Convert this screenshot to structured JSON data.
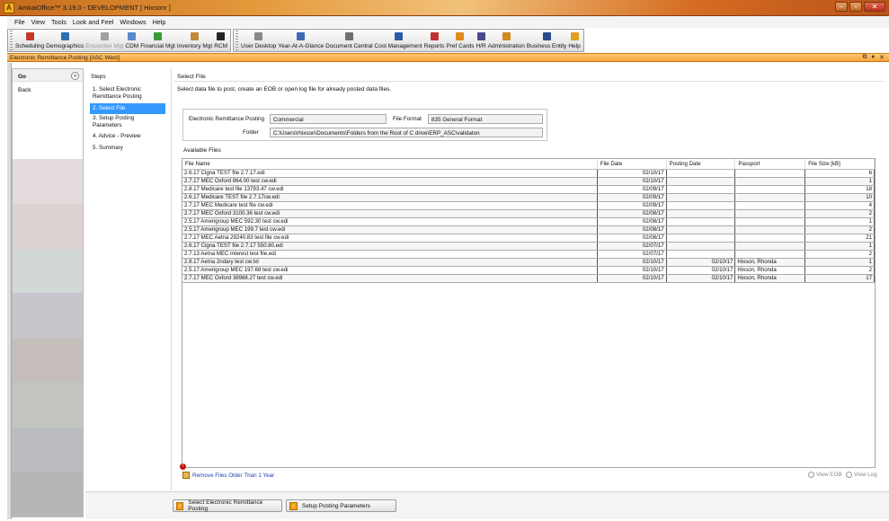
{
  "window": {
    "title": "AmkaiOffice™ 3.19.0 - DEVELOPMENT [ Hixsonr ]"
  },
  "menubar": [
    "File",
    "View",
    "Tools",
    "Look and Feel",
    "Windows",
    "Help"
  ],
  "toolbar": {
    "group1": [
      {
        "label": "Scheduling",
        "icon": "calendar-icon",
        "color": "#c0392b",
        "enabled": true
      },
      {
        "label": "Demographics",
        "icon": "people-icon",
        "color": "#2c6fb3",
        "enabled": true
      },
      {
        "label": "Encounter Mgt",
        "icon": "encounter-icon",
        "color": "#a0a0a0",
        "enabled": false
      },
      {
        "label": "CDM",
        "icon": "cdm-icon",
        "color": "#5a8acb",
        "enabled": true
      },
      {
        "label": "Financial Mgt",
        "icon": "money-icon",
        "color": "#3a9a3a",
        "enabled": true
      },
      {
        "label": "Inventory Mgt",
        "icon": "inventory-icon",
        "color": "#c08a3a",
        "enabled": true
      },
      {
        "label": "RCM",
        "icon": "rcm-icon",
        "color": "#222222",
        "enabled": true
      }
    ],
    "group2": [
      {
        "label": "User Desktop",
        "icon": "desktop-icon",
        "color": "#888888",
        "enabled": true
      },
      {
        "label": "Year-At-A-Glance",
        "icon": "year-calendar-icon",
        "color": "#3a6ab0",
        "enabled": true
      },
      {
        "label": "Document Central",
        "icon": "document-icon",
        "color": "#707070",
        "enabled": true
      },
      {
        "label": "Cost Management",
        "icon": "cost-icon",
        "color": "#2a5aa8",
        "enabled": true
      },
      {
        "label": "Reports",
        "icon": "reports-icon",
        "color": "#c03030",
        "enabled": true
      },
      {
        "label": "Pref Cards",
        "icon": "pref-cards-icon",
        "color": "#e08a20",
        "enabled": true
      },
      {
        "label": "H/R",
        "icon": "hr-icon",
        "color": "#4a4a8a",
        "enabled": true
      },
      {
        "label": "Administration",
        "icon": "admin-icon",
        "color": "#d08a20",
        "enabled": true
      },
      {
        "label": "Business Entity",
        "icon": "business-icon",
        "color": "#2a4a8a",
        "enabled": true
      },
      {
        "label": "Help",
        "icon": "help-icon",
        "color": "#e0a020",
        "enabled": true
      }
    ]
  },
  "document": {
    "title": "Electronic Remittance Posting [ASC West]"
  },
  "nav": {
    "go": "Go",
    "back": "Back"
  },
  "steps": {
    "title": "Steps",
    "items": [
      {
        "label": "1. Select Electronic\nRemittance Posting",
        "active": false
      },
      {
        "label": "2. Select File",
        "active": true
      },
      {
        "label": "3. Setup Posting Parameters",
        "active": false
      },
      {
        "label": "4. Advice - Preview",
        "active": false
      },
      {
        "label": "5. Summary",
        "active": false
      }
    ]
  },
  "main": {
    "title": "Select File",
    "instruction": "Select data file to post, create an EOB or open log file for already posted data files.",
    "form": {
      "erp_label": "Electronic Remittance Posting",
      "erp_value": "Commercial",
      "format_label": "File Format",
      "format_value": "835 General Format",
      "folder_label": "Folder",
      "folder_value": "C:\\Users\\rhixson\\Documents\\Folders from the Root of C drive\\ERP_ASC\\validaton"
    },
    "available_label": "Available Files",
    "table": {
      "columns": [
        "File Name",
        "File Date",
        "Posting Date",
        "Passport",
        "File Size [kB]"
      ],
      "rows": [
        [
          "2.6.17 Cigna TEST file 2.7.17.edi",
          "02/10/17",
          "",
          "",
          "6"
        ],
        [
          "2.7.17 MEC Oxford 864.00 test cw.edi",
          "02/10/17",
          "",
          "",
          "1"
        ],
        [
          "2.8.17 Medicare test file 13793.47 cw.edi",
          "02/09/17",
          "",
          "",
          "18"
        ],
        [
          "2.6.17 Medicare TEST file 2.7.17cw.edi",
          "02/09/17",
          "",
          "",
          "10"
        ],
        [
          "2.7.17 MEC Medicare test file cw.edi",
          "02/09/17",
          "",
          "",
          "4"
        ],
        [
          "2.7.17 MEC Oxford 3100.36 test cw.edi",
          "02/08/17",
          "",
          "",
          "2"
        ],
        [
          "2.5.17 Amerigroup MEC 592.30 test cw.edi",
          "02/08/17",
          "",
          "",
          "1"
        ],
        [
          "2.5.17 Amerigroup MEC 199.7 test cw.edi",
          "02/08/17",
          "",
          "",
          "2"
        ],
        [
          "2.7.17 MEC Aetna 29240.83 test file cw.edi",
          "02/08/17",
          "",
          "",
          "21"
        ],
        [
          "2.6.17 Cigna TEST file 2.7.17 550.80.edi",
          "02/07/17",
          "",
          "",
          "1"
        ],
        [
          "2.7.13 Aetna MEC interest test file.edi",
          "02/07/17",
          "",
          "",
          "2"
        ],
        [
          "2.8.17 Aetna 2ndary test cw.txt",
          "02/10/17",
          "02/10/17",
          "Hixson, Rhonda",
          "1"
        ],
        [
          "2.5.17 Amerigroup MEC 197.68 test cw.edi",
          "02/10/17",
          "02/10/17",
          "Hixson, Rhonda",
          "2"
        ],
        [
          "2.7.17 MEC Oxford 38988.27 test cw.edi",
          "02/10/17",
          "02/10/17",
          "Hixson, Rhonda",
          "17"
        ]
      ]
    },
    "remove_link": "Remove Files Older Than 1 Year",
    "view_eob": "View EOB",
    "view_log": "View Log"
  },
  "buttons": {
    "back": "Select Electronic Remittance Posting",
    "next": "Setup Posting Parameters"
  },
  "colors": {
    "accent": "#3399ff",
    "doc_title": "#f7a63a",
    "link": "#1f3fb0"
  }
}
